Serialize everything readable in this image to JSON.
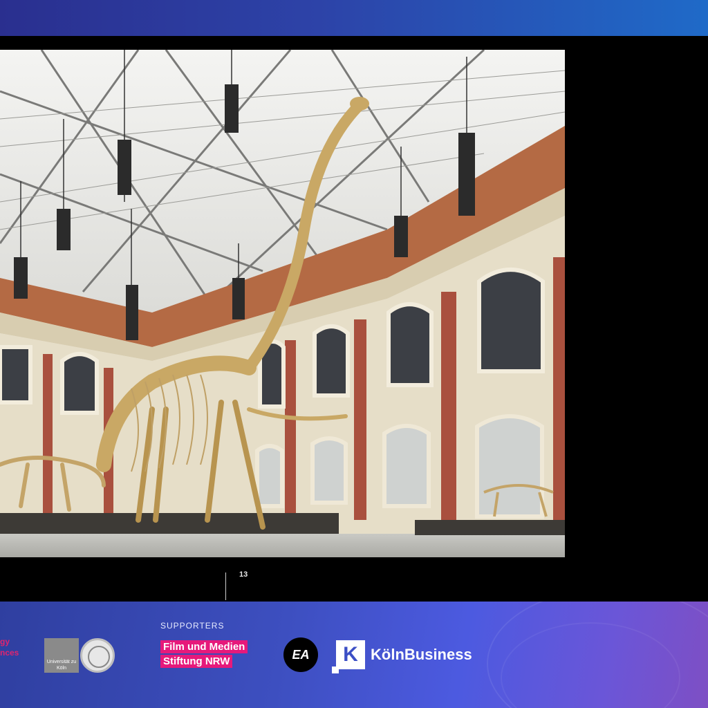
{
  "slide": {
    "page_number": "13",
    "photo_subject": "dinosaur-skeleton-hall"
  },
  "footer": {
    "partner_text_line1": "gy",
    "partner_text_line2": "nces",
    "university_logo_text": "Universität zu Köln",
    "supporters_label": "SUPPORTERS",
    "filmstiftung_line1": "Film und Medien",
    "filmstiftung_line2": "Stiftung NRW",
    "ea_logo_text": "EA",
    "koeln_mark_letter": "K",
    "koeln_business_text": "KölnBusiness"
  },
  "colors": {
    "topbar_start": "#2a2f8f",
    "topbar_end": "#1f6ac8",
    "footer_accent": "#4c5ae0",
    "film_pink": "#e6197b",
    "partner_red": "#e0246e"
  }
}
